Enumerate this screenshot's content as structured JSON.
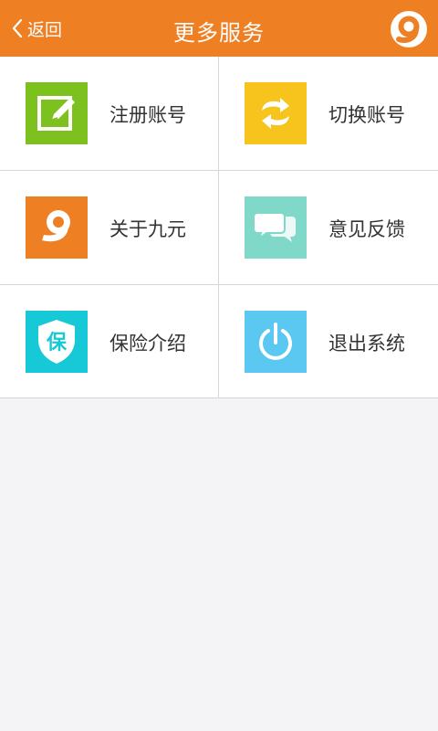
{
  "header": {
    "back_label": "返回",
    "title": "更多服务",
    "logo_icon": "nine-logo-icon",
    "background": "#ee7f22"
  },
  "menu": [
    {
      "label": "注册账号",
      "icon": "edit-icon",
      "color": "#7dc11e"
    },
    {
      "label": "切换账号",
      "icon": "refresh-icon",
      "color": "#f6c41c"
    },
    {
      "label": "关于九元",
      "icon": "nine-logo-icon",
      "color": "#ee7f22"
    },
    {
      "label": "意见反馈",
      "icon": "chat-icon",
      "color": "#7fd8c8"
    },
    {
      "label": "保险介绍",
      "icon": "shield-icon",
      "color": "#17c8d6",
      "icon_text": "保"
    },
    {
      "label": "退出系统",
      "icon": "power-icon",
      "color": "#5bc8f2"
    }
  ]
}
